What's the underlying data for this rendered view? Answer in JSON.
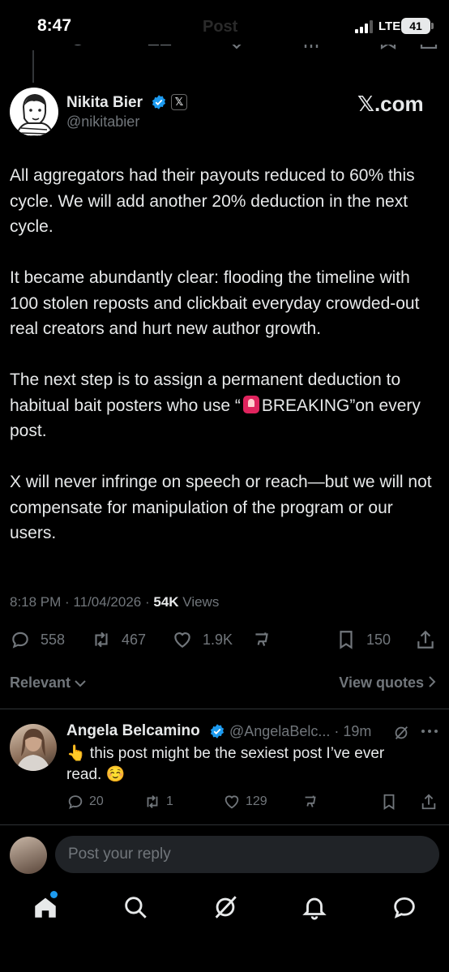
{
  "status_bar": {
    "time": "8:47",
    "faint_title": "Post",
    "network": "LTE",
    "battery": "41"
  },
  "tweet": {
    "author_name": "Nikita Bier",
    "author_handle": "@nikitabier",
    "x_badge": "𝕏",
    "affiliation": "𝕏.com",
    "paragraphs": [
      "All aggregators had their payouts reduced to 60% this cycle. We will add another 20% deduction in the next cycle.",
      "It became abundantly clear: flooding the timeline with 100 stolen reposts and clickbait everyday crowded-out real creators and hurt new author growth.",
      "X will never infringe on speech or reach—but we will not compensate for manipulation of the program or our users."
    ],
    "breaking_pre": "The next step is to assign a permanent deduction to habitual bait posters who use “",
    "breaking_word": "BREAKING",
    "breaking_post": "”on every post.",
    "time": "8:18 PM",
    "date": "11/04/2026",
    "views_count": "54K",
    "views_label": "Views",
    "replies": "558",
    "reposts": "467",
    "likes": "1.9K",
    "bookmarks": "150"
  },
  "sort": {
    "relevant": "Relevant",
    "view_quotes": "View quotes"
  },
  "reply": {
    "name": "Angela Belcamino",
    "handle_time": "@AngelaBelc... · 19m",
    "text": "👆 this post might be the sexiest post I’ve ever read. ☺️",
    "replies": "20",
    "reposts": "1",
    "likes": "129"
  },
  "compose": {
    "placeholder": "Post your reply"
  },
  "colors": {
    "background": "#000000",
    "text": "#e7e9ea",
    "muted": "#71767b",
    "verified": "#1d9bf0",
    "divider": "#2f3336"
  },
  "icons": [
    "reply-icon",
    "repost-icon",
    "like-icon",
    "views-icon",
    "bookmark-icon",
    "share-icon",
    "grok-icon",
    "more-icon",
    "home-icon",
    "search-icon",
    "notifications-icon",
    "messages-icon"
  ]
}
